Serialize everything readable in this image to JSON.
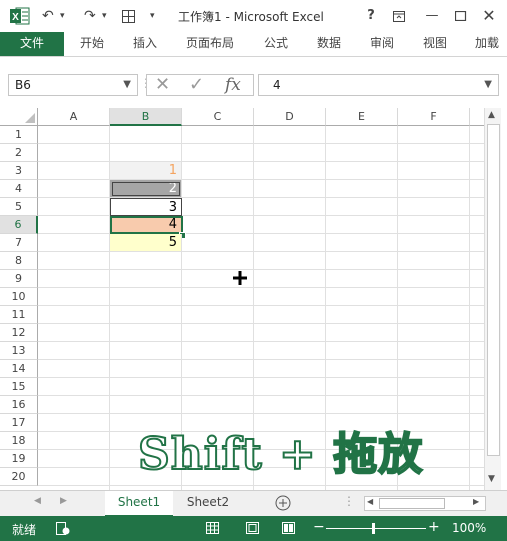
{
  "titlebar": {
    "title": "工作簿1 - Microsoft Excel",
    "undo_icon": "undo-icon",
    "redo_icon": "redo-icon",
    "help": "?",
    "restore_icon": "ribbon-display-icon",
    "minimize_icon": "minimize-icon",
    "maximize_icon": "maximize-icon",
    "close_icon": "close-icon"
  },
  "ribbon": {
    "tabs": [
      "文件",
      "开始",
      "插入",
      "页面布局",
      "公式",
      "数据",
      "审阅",
      "视图",
      "加载"
    ]
  },
  "formula_bar": {
    "name_box": "B6",
    "fx": "fx",
    "value": "4"
  },
  "columns": [
    "A",
    "B",
    "C",
    "D",
    "E",
    "F"
  ],
  "rows": [
    "1",
    "2",
    "3",
    "4",
    "5",
    "6",
    "7",
    "8",
    "9",
    "10",
    "11",
    "12",
    "13",
    "14",
    "15",
    "16",
    "17",
    "18",
    "19",
    "20"
  ],
  "cells": {
    "B3": "1",
    "B4": "2",
    "B5": "3",
    "B6": "4",
    "B7": "5"
  },
  "overlay_text": "Shift + 拖放",
  "sheets": [
    "Sheet1",
    "Sheet2"
  ],
  "status": {
    "ready": "就绪",
    "zoom": "100%"
  },
  "colors": {
    "excel_green": "#217346",
    "b3_bg": "#f2f2f2",
    "b3_text": "#f4a460",
    "b4_bg": "#a6a6a6",
    "b6_bg": "#f8cbad",
    "b7_bg": "#ffffcc"
  }
}
